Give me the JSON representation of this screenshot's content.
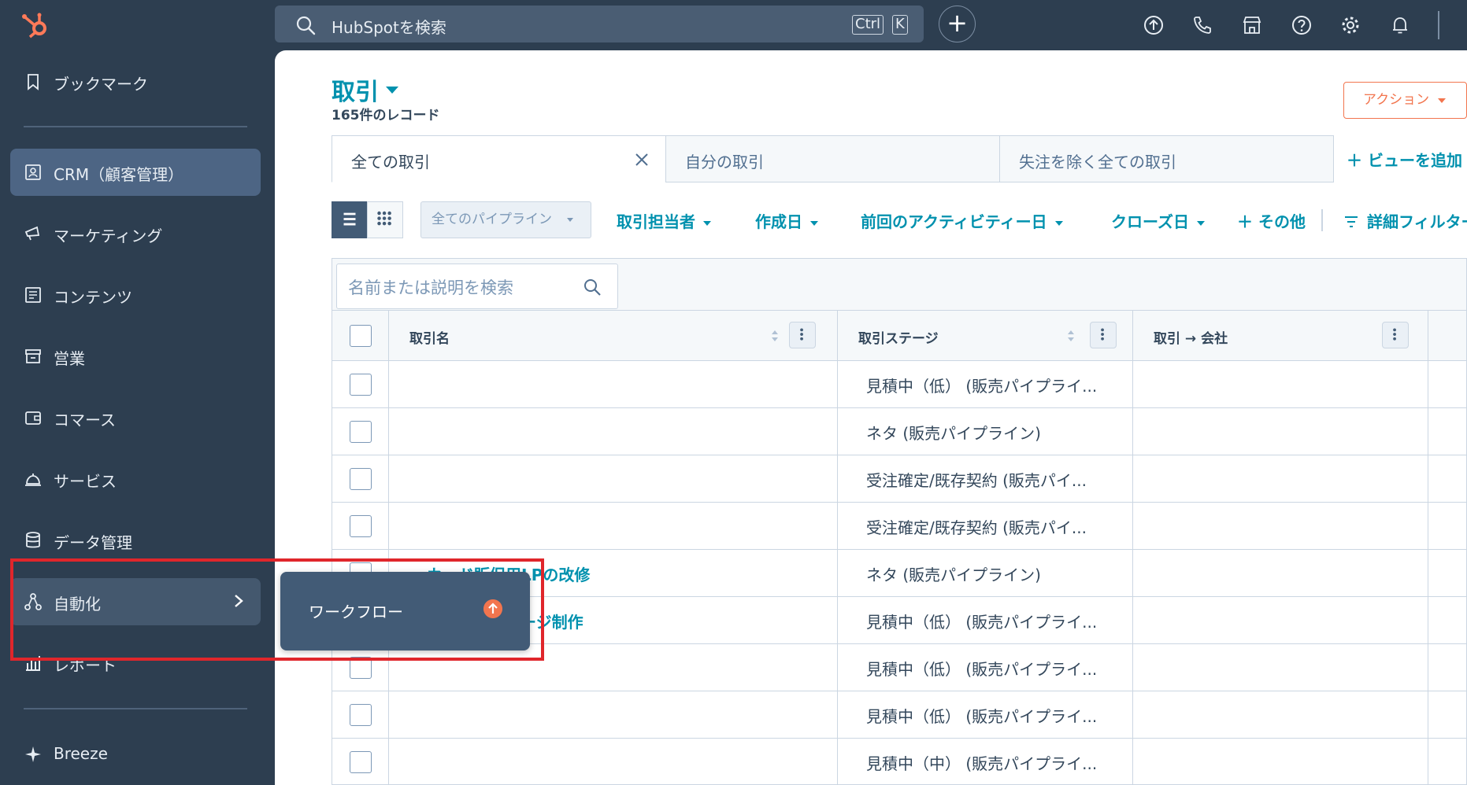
{
  "search": {
    "placeholder": "HubSpotを検索",
    "shortcut_ctrl": "Ctrl",
    "shortcut_key": "K"
  },
  "topbar": {
    "icons": [
      "upgrade-icon",
      "phone-icon",
      "marketplace-icon",
      "help-icon",
      "settings-icon",
      "notifications-icon"
    ]
  },
  "sidebar": {
    "items": [
      {
        "label": "ブックマーク",
        "icon": "bookmark-icon"
      },
      {
        "label": "CRM（顧客管理）",
        "icon": "contacts-icon"
      },
      {
        "label": "マーケティング",
        "icon": "megaphone-icon"
      },
      {
        "label": "コンテンツ",
        "icon": "content-icon"
      },
      {
        "label": "営業",
        "icon": "sales-icon"
      },
      {
        "label": "コマース",
        "icon": "wallet-icon"
      },
      {
        "label": "サービス",
        "icon": "service-bell-icon"
      },
      {
        "label": "データ管理",
        "icon": "database-icon"
      },
      {
        "label": "自動化",
        "icon": "automation-icon"
      },
      {
        "label": "レポート",
        "icon": "reports-icon"
      },
      {
        "label": "Breeze",
        "icon": "breeze-sparkle-icon"
      }
    ]
  },
  "flyout": {
    "item_label": "ワークフロー",
    "badge": "upgrade-arrow-icon"
  },
  "page": {
    "title": "取引",
    "record_count": "165件のレコード",
    "action_button": "アクション"
  },
  "tabs": [
    {
      "label": "全ての取引",
      "active": true
    },
    {
      "label": "自分の取引",
      "active": false
    },
    {
      "label": "失注を除く全ての取引",
      "active": false
    }
  ],
  "add_view": "＋ ビューを追加",
  "filters": {
    "pipeline": "全てのパイプライン",
    "owner": "取引担当者",
    "created": "作成日",
    "last_activity": "前回のアクティビティー日",
    "close_date": "クローズ日",
    "more": "＋ その他",
    "advanced": "詳細フィルター"
  },
  "table": {
    "search_placeholder": "名前または説明を検索",
    "columns": [
      "取引名",
      "取引ステージ",
      "取引 → 会社"
    ],
    "rows": [
      {
        "name": "",
        "stage": "見積中（低） (販売パイプライ..."
      },
      {
        "name": "",
        "stage": "ネタ (販売パイプライン)"
      },
      {
        "name": "",
        "stage": "受注確定/既存契約 (販売パイ..."
      },
      {
        "name": "",
        "stage": "受注確定/既存契約 (販売パイ..."
      },
      {
        "name": "ーカード販促用LPの改修",
        "stage": "ネタ (販売パイプライン)"
      },
      {
        "name": "ェアイベントページ制作",
        "stage": "見積中（低） (販売パイプライ..."
      },
      {
        "name": "",
        "stage": "見積中（低） (販売パイプライ..."
      },
      {
        "name": "",
        "stage": "見積中（低） (販売パイプライ..."
      },
      {
        "name": "",
        "stage": "見積中（中） (販売パイプライ..."
      }
    ]
  },
  "colors": {
    "nav_bg": "#2d3e50",
    "accent": "#0091ae",
    "orange": "#f2754e",
    "highlight": "#e0262b"
  }
}
